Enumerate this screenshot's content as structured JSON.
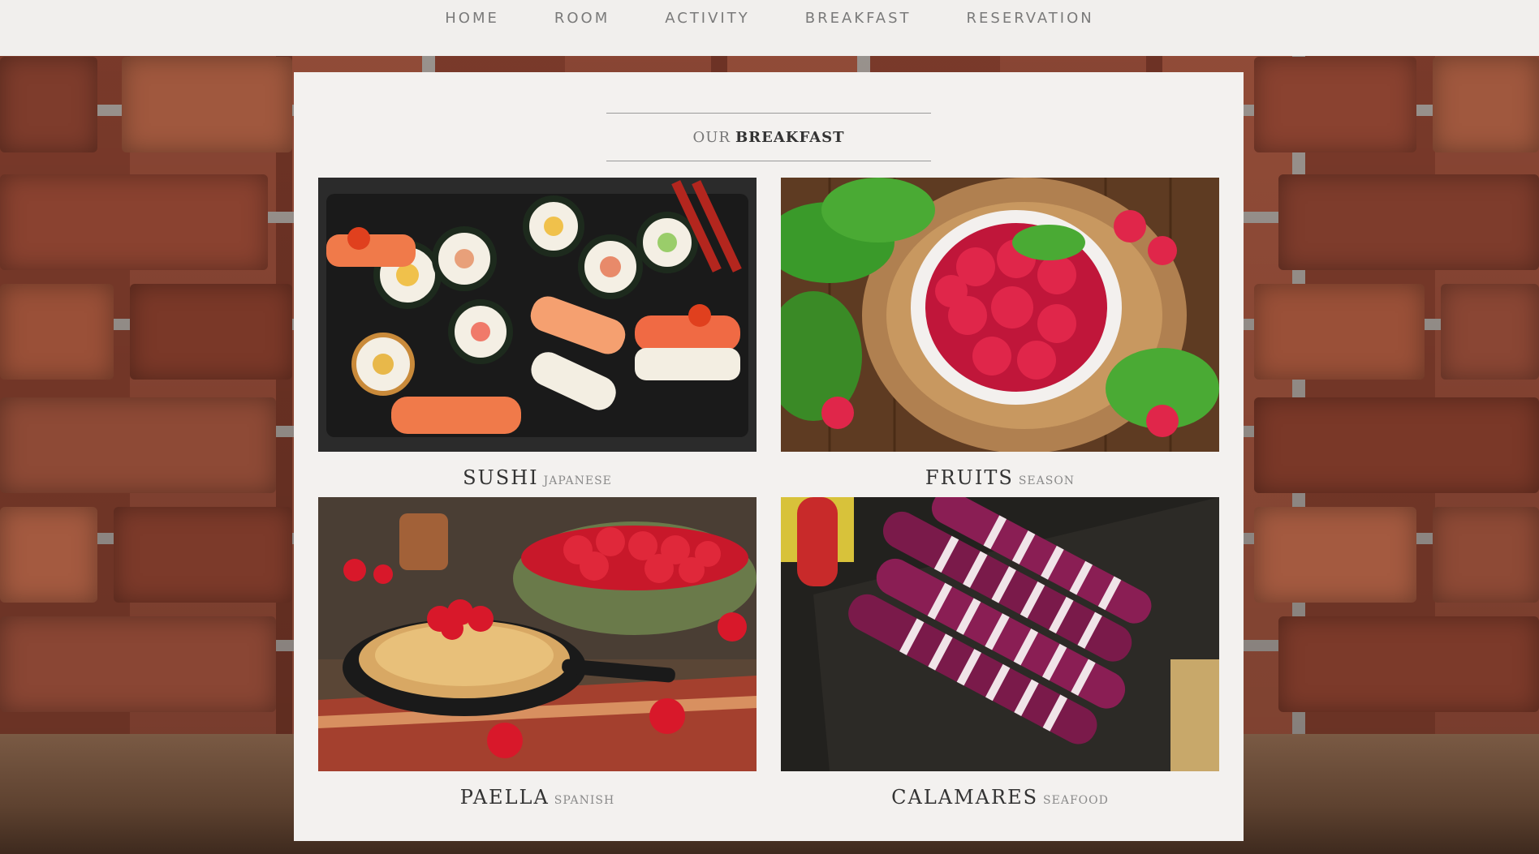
{
  "nav": {
    "items": [
      {
        "label": "HOME"
      },
      {
        "label": "ROOM"
      },
      {
        "label": "ACTIVITY"
      },
      {
        "label": "BREAKFAST"
      },
      {
        "label": "RESERVATION"
      }
    ]
  },
  "section": {
    "heading_light": "OUR",
    "heading_bold": "BREAKFAST"
  },
  "cards": [
    {
      "name": "SUSHI",
      "sub": "JAPANESE",
      "image": "sushi-platter"
    },
    {
      "name": "FRUITS",
      "sub": "SEASON",
      "image": "raspberry-bowl"
    },
    {
      "name": "PAELLA",
      "sub": "SPANISH",
      "image": "strawberry-pancake"
    },
    {
      "name": "CALAMARES",
      "sub": "SEAFOOD",
      "image": "grilled-squid"
    }
  ],
  "colors": {
    "nav_bg": "#f1efed",
    "panel_bg": "#f3f1ef",
    "nav_text": "#7a7a7a",
    "title_text": "#333333"
  }
}
